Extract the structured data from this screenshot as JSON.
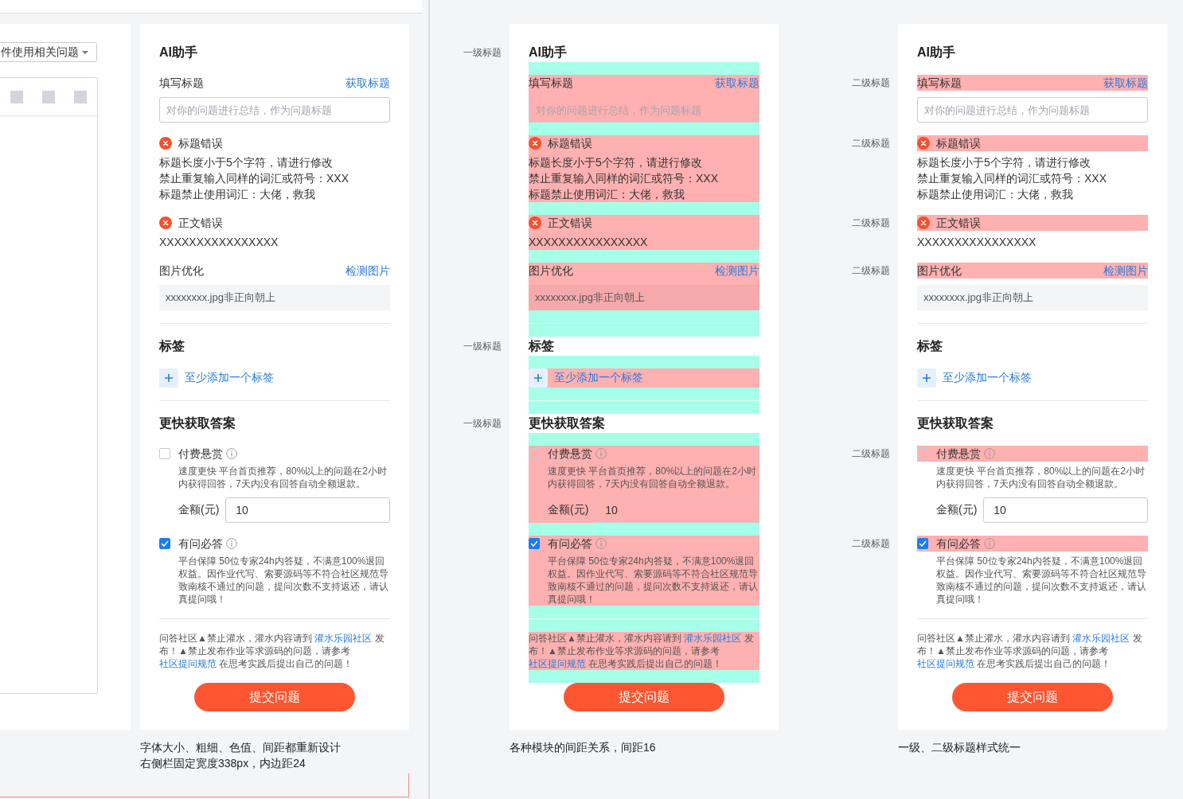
{
  "panels": [
    {
      "kind": "plain",
      "form_fragment": {
        "category": "件使用相关问题"
      },
      "sections": [
        {
          "title": "AI助手",
          "blocks": [
            {
              "kind": "field",
              "label": "填写标题",
              "action": "获取标题",
              "placeholder": "对你的问题进行总结，作为问题标题"
            },
            {
              "kind": "error",
              "title": "标题错误",
              "lines": [
                "标题长度小于5个字符，请进行修改",
                "禁止重复输入同样的词汇或符号：XXX",
                "标题禁止使用词汇：大佬，救我"
              ]
            },
            {
              "kind": "error",
              "title": "正文错误",
              "lines": [
                "XXXXXXXXXXXXXXXX"
              ]
            },
            {
              "kind": "notice",
              "label": "图片优化",
              "action": "检测图片",
              "value": "xxxxxxxx.jpg非正向朝上"
            }
          ]
        },
        {
          "title": "标签",
          "blocks": [
            {
              "kind": "tag_add",
              "text": "至少添加一个标签"
            }
          ]
        },
        {
          "title": "更快获取答案",
          "blocks": [
            {
              "kind": "option",
              "label": "付费悬赏",
              "checked": false,
              "description": "速度更快 平台首页推荐，80%以上的问题在2小时内获得回答，7天内没有回答自动全额退款。",
              "amount_label": "金额(元)",
              "amount": "10"
            },
            {
              "kind": "option",
              "label": "有问必答",
              "checked": true,
              "description": "平台保障 50位专家24h内答疑，不满意100%退回权益。因作业代写、索要源码等不符合社区规范导致南核不通过的问题，提问次数不支持返还，请认真提问哦！"
            }
          ]
        }
      ],
      "footer": [
        {
          "kind": "text",
          "text": "问答社区▲禁止灌水，灌水内容请到 "
        },
        {
          "kind": "link",
          "text": "灌水乐园社区"
        },
        {
          "kind": "text",
          "text": " 发布！▲禁止发布作业等求源码的问题，请参考 "
        },
        {
          "kind": "link",
          "text": "社区提问规范"
        },
        {
          "kind": "text",
          "text": " 在思考实践后提出自己的问题！"
        }
      ],
      "submit": "提交问题",
      "caption": [
        "字体大小、粗细、色值、间距都重新设计",
        "右侧栏固定宽度338px，内边距24"
      ]
    },
    {
      "kind": "spacing",
      "sections": [
        {
          "title": "AI助手",
          "side_label": "一级标题",
          "blocks": [
            {
              "kind": "field",
              "label": "填写标题",
              "action": "获取标题",
              "placeholder": "对你的问题进行总结，作为问题标题"
            },
            {
              "kind": "error",
              "title": "标题错误",
              "lines": [
                "标题长度小于5个字符，请进行修改",
                "禁止重复输入同样的词汇或符号：XXX",
                "标题禁止使用词汇：大佬，救我"
              ]
            },
            {
              "kind": "error",
              "title": "正文错误",
              "lines": [
                "XXXXXXXXXXXXXXXX"
              ]
            },
            {
              "kind": "notice",
              "label": "图片优化",
              "action": "检测图片",
              "value": "xxxxxxxx.jpg非正向朝上"
            }
          ]
        },
        {
          "title": "标签",
          "side_label": "一级标题",
          "blocks": [
            {
              "kind": "tag_add",
              "text": "至少添加一个标签"
            }
          ]
        },
        {
          "title": "更快获取答案",
          "side_label": "一级标题",
          "blocks": [
            {
              "kind": "option",
              "label": "付费悬赏",
              "checked": false,
              "description": "速度更快 平台首页推荐，80%以上的问题在2小时内获得回答，7天内没有回答自动全额退款。",
              "amount_label": "金额(元)",
              "amount": "10"
            },
            {
              "kind": "option",
              "label": "有问必答",
              "checked": true,
              "description": "平台保障 50位专家24h内答疑，不满意100%退回权益。因作业代写、索要源码等不符合社区规范导致南核不通过的问题，提问次数不支持返还，请认真提问哦！"
            }
          ]
        }
      ],
      "footer": [
        {
          "kind": "text",
          "text": "问答社区▲禁止灌水，灌水内容请到 "
        },
        {
          "kind": "link",
          "text": "灌水乐园社区"
        },
        {
          "kind": "text",
          "text": " 发布！▲禁止发布作业等求源码的问题，请参考 "
        },
        {
          "kind": "link",
          "text": "社区提问规范"
        },
        {
          "kind": "text",
          "text": " 在思考实践后提出自己的问题！"
        }
      ],
      "submit": "提交问题",
      "caption": [
        "各种模块的间距关系，间距16"
      ]
    },
    {
      "kind": "headings",
      "sections": [
        {
          "title": "AI助手",
          "blocks": [
            {
              "kind": "field",
              "label": "填写标题",
              "action": "获取标题",
              "placeholder": "对你的问题进行总结，作为问题标题",
              "side_label": "二级标题"
            },
            {
              "kind": "error",
              "title": "标题错误",
              "lines": [
                "标题长度小于5个字符，请进行修改",
                "禁止重复输入同样的词汇或符号：XXX",
                "标题禁止使用词汇：大佬，救我"
              ],
              "side_label": "二级标题"
            },
            {
              "kind": "error",
              "title": "正文错误",
              "lines": [
                "XXXXXXXXXXXXXXXX"
              ],
              "side_label": "二级标题"
            },
            {
              "kind": "notice",
              "label": "图片优化",
              "action": "检测图片",
              "value": "xxxxxxxx.jpg非正向朝上",
              "side_label": "二级标题"
            }
          ]
        },
        {
          "title": "标签",
          "blocks": [
            {
              "kind": "tag_add",
              "text": "至少添加一个标签"
            }
          ]
        },
        {
          "title": "更快获取答案",
          "blocks": [
            {
              "kind": "option",
              "label": "付费悬赏",
              "checked": false,
              "description": "速度更快 平台首页推荐，80%以上的问题在2小时内获得回答，7天内没有回答自动全额退款。",
              "amount_label": "金额(元)",
              "amount": "10",
              "side_label": "二级标题"
            },
            {
              "kind": "option",
              "label": "有问必答",
              "checked": true,
              "description": "平台保障 50位专家24h内答疑，不满意100%退回权益。因作业代写、索要源码等不符合社区规范导致南核不通过的问题，提问次数不支持返还，请认真提问哦！",
              "side_label": "二级标题"
            }
          ]
        }
      ],
      "footer": [
        {
          "kind": "text",
          "text": "问答社区▲禁止灌水，灌水内容请到 "
        },
        {
          "kind": "link",
          "text": "灌水乐园社区"
        },
        {
          "kind": "text",
          "text": " 发布！▲禁止发布作业等求源码的问题，请参考 "
        },
        {
          "kind": "link",
          "text": "社区提问规范"
        },
        {
          "kind": "text",
          "text": " 在思考实践后提出自己的问题！"
        }
      ],
      "submit": "提交问题",
      "caption": [
        "一级、二级标题样式统一"
      ]
    }
  ]
}
